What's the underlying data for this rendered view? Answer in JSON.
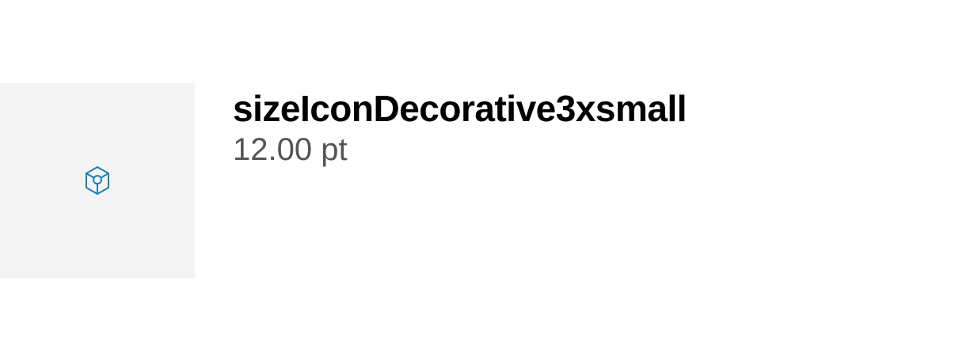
{
  "token": {
    "name": "sizeIconDecorative3xsmall",
    "value": "12.00 pt",
    "icon": "cube-icon",
    "icon_color": "#1a7fb4",
    "tile_background": "#f4f4f4"
  }
}
